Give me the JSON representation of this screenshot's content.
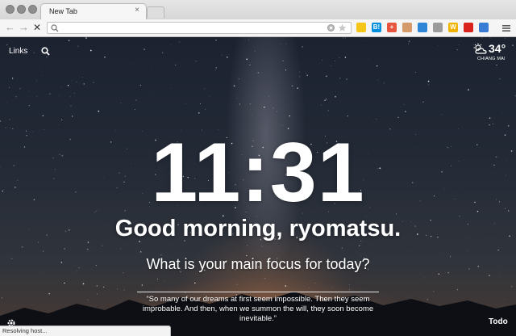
{
  "browser": {
    "tab_title": "New Tab",
    "tab_close": "×",
    "address_value": "",
    "address_placeholder": "",
    "nav": {
      "back": "←",
      "forward": "→",
      "stop": "✕"
    },
    "menu_glyph": "≡",
    "extensions": [
      {
        "icon": "pocket-icon",
        "glyph": "",
        "color": "#f5c518"
      },
      {
        "icon": "hatena-bookmark-icon",
        "glyph": "B!",
        "color": "#008fde"
      },
      {
        "icon": "add-icon",
        "glyph": "+",
        "color": "#e8553e"
      },
      {
        "icon": "avatar-ext-icon",
        "glyph": "",
        "color": "#d49a6a"
      },
      {
        "icon": "chart-ext-icon",
        "glyph": "",
        "color": "#2f86d6"
      },
      {
        "icon": "grey-circle-ext-icon",
        "glyph": "",
        "color": "#9c9c9c"
      },
      {
        "icon": "w-ext-icon",
        "glyph": "W",
        "color": "#f0b400"
      },
      {
        "icon": "flag-ext-icon",
        "glyph": "",
        "color": "#d9231c"
      },
      {
        "icon": "sync-ext-icon",
        "glyph": "",
        "color": "#3a7bd5"
      }
    ],
    "status_text": "Resolving host..."
  },
  "momentum": {
    "links_label": "Links",
    "weather": {
      "temperature": "34°",
      "location": "CHIANG MAI",
      "icon": "partly-cloudy-icon"
    },
    "clock": "11:31",
    "greeting": "Good morning, ryomatsu.",
    "focus_question": "What is your main focus for today?",
    "quote": "“So many of our dreams at first seem impossible. Then they seem improbable. And then, when we summon the will, they soon become inevitable.”",
    "todo_label": "Todo"
  },
  "colors": {
    "text": "#ffffff",
    "toolbar_bg": "#f5f5f5",
    "tab_strip_bg": "#dcdcdc"
  }
}
